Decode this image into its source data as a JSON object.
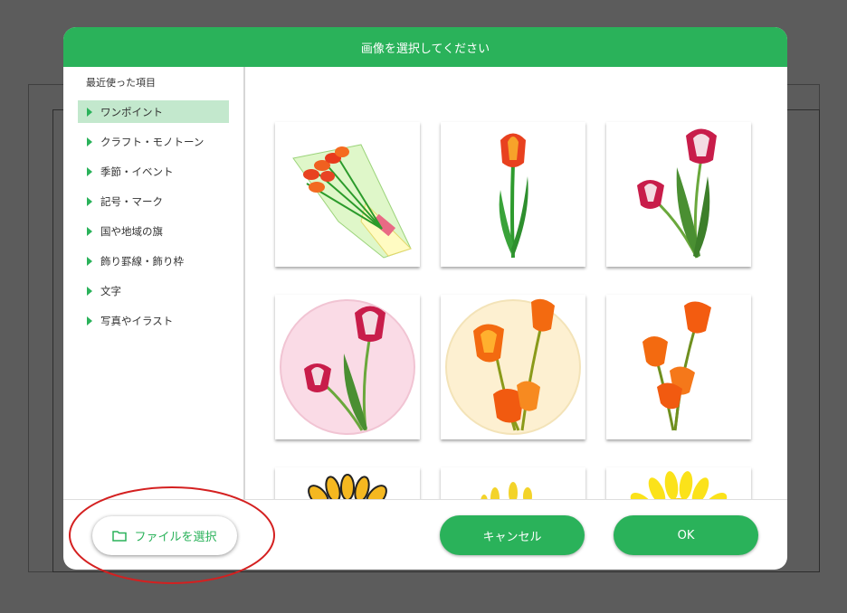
{
  "dialog": {
    "title": "画像を選択してください"
  },
  "sidebar": {
    "recent_label": "最近使った項目",
    "categories": [
      {
        "label": "ワンポイント",
        "selected": true
      },
      {
        "label": "クラフト・モノトーン",
        "selected": false
      },
      {
        "label": "季節・イベント",
        "selected": false
      },
      {
        "label": "記号・マーク",
        "selected": false
      },
      {
        "label": "国や地域の旗",
        "selected": false
      },
      {
        "label": "飾り罫線・飾り枠",
        "selected": false
      },
      {
        "label": "文字",
        "selected": false
      },
      {
        "label": "写真やイラスト",
        "selected": false
      }
    ]
  },
  "gallery": {
    "items": [
      {
        "icon": "tulip-bouquet-icon"
      },
      {
        "icon": "single-red-tulip-icon"
      },
      {
        "icon": "pink-white-tulips-icon"
      },
      {
        "icon": "tulips-pink-circle-icon"
      },
      {
        "icon": "orange-tulips-cream-circle-icon"
      },
      {
        "icon": "orange-tulips-icon"
      },
      {
        "icon": "sunflower-outline-icon"
      },
      {
        "icon": "yellow-flower-icon"
      },
      {
        "icon": "sunflower-icon"
      }
    ]
  },
  "footer": {
    "file_button_label": "ファイルを選択",
    "cancel_label": "キャンセル",
    "ok_label": "OK"
  },
  "colors": {
    "accent": "#2ab25a",
    "selected_bg": "#c3e8cd",
    "annotation": "#d42020"
  }
}
